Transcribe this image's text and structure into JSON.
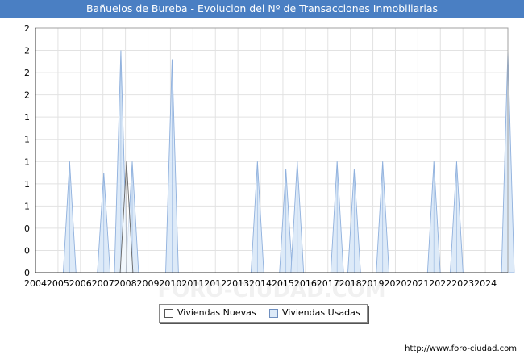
{
  "header": {
    "title": "Bañuelos de Bureba - Evolucion del Nº de Transacciones Inmobiliarias",
    "title_bar_color": "#4a7fc3"
  },
  "legend": {
    "nuevas_label": "Viviendas Nuevas",
    "usadas_label": "Viviendas Usadas"
  },
  "footer": {
    "url": "http://www.foro-ciudad.com"
  },
  "watermark": {
    "text": "FORO-CIUDAD.COM"
  },
  "chart_data": {
    "type": "area",
    "title": "Bañuelos de Bureba - Evolucion del Nº de Transacciones Inmobiliarias",
    "xlabel": "",
    "ylabel": "",
    "xlim": [
      2004,
      2024.75
    ],
    "ylim": [
      0,
      2.2
    ],
    "grid": true,
    "legend_position": "bottom-center",
    "x_tick_labels": [
      "2004",
      "2005",
      "2006",
      "2007",
      "2008",
      "2009",
      "2010",
      "2011",
      "2012",
      "2013",
      "2014",
      "2015",
      "2016",
      "2017",
      "2018",
      "2019",
      "2020",
      "2021",
      "2022",
      "2023",
      "2024"
    ],
    "y_ticks": [
      0,
      0.2,
      0.4,
      0.6,
      0.8,
      1.0,
      1.2,
      1.4,
      1.6,
      1.8,
      2.0,
      2.2
    ],
    "y_tick_labels": [
      "0",
      "0",
      "0",
      "1",
      "1",
      "1",
      "1",
      "1",
      "2",
      "2",
      "2",
      "2"
    ],
    "series": [
      {
        "name": "Viviendas Usadas",
        "color": "#ddeaf8",
        "stroke": "#8fb0dd",
        "spikes": [
          {
            "x": 2005.5,
            "y": 1
          },
          {
            "x": 2007.0,
            "y": 0.9
          },
          {
            "x": 2007.75,
            "y": 2
          },
          {
            "x": 2008.25,
            "y": 1
          },
          {
            "x": 2010.0,
            "y": 1.92
          },
          {
            "x": 2013.75,
            "y": 1
          },
          {
            "x": 2015.0,
            "y": 0.93
          },
          {
            "x": 2015.5,
            "y": 1
          },
          {
            "x": 2017.25,
            "y": 1
          },
          {
            "x": 2018.0,
            "y": 0.93
          },
          {
            "x": 2019.25,
            "y": 1
          },
          {
            "x": 2021.5,
            "y": 1
          },
          {
            "x": 2022.5,
            "y": 1
          },
          {
            "x": 2024.75,
            "y": 2
          }
        ]
      },
      {
        "name": "Viviendas Nuevas",
        "color": "#ffffff",
        "stroke": "#666666",
        "spikes": [
          {
            "x": 2008.0,
            "y": 1
          }
        ]
      }
    ]
  }
}
